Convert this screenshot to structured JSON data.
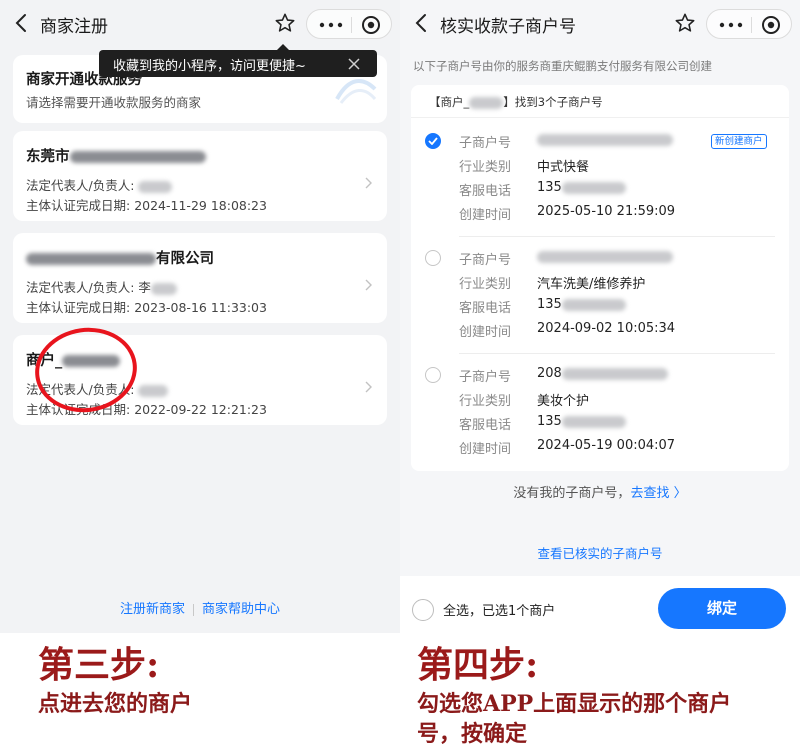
{
  "left": {
    "nav_title": "商家注册",
    "tooltip": "收藏到我的小程序，访问更便捷~",
    "card_intro": {
      "title": "商家开通收款服务",
      "sub": "请选择需要开通收款服务的商家"
    },
    "merchants": [
      {
        "name_prefix": "东莞市",
        "name_suffix": "",
        "rep_label": "法定代表人/负责人:",
        "date_label": "主体认证完成日期:",
        "date": "2024-11-29 18:08:23"
      },
      {
        "name_prefix": "",
        "name_suffix": "有限公司",
        "rep_label": "法定代表人/负责人:",
        "rep_prefix": "李",
        "date_label": "主体认证完成日期:",
        "date": "2023-08-16 11:33:03"
      },
      {
        "name_prefix": "商户_",
        "name_suffix": "",
        "rep_label": "法定代表人/负责人:",
        "date_label": "主体认证完成日期:",
        "date": "2022-09-22 12:21:23"
      }
    ],
    "footer": {
      "register": "注册新商家",
      "help": "商家帮助中心"
    },
    "caption_title": "第三步:",
    "caption_sub": "点进去您的商户"
  },
  "right": {
    "nav_title": "核实收款子商户号",
    "desc": "以下子商户号由你的服务商重庆鲲鹏支付服务有限公司创建",
    "found_prefix": "【商户_",
    "found_suffix": "】找到3个子商户号",
    "labels": {
      "sub_no": "子商户号",
      "industry": "行业类别",
      "phone": "客服电话",
      "created": "创建时间"
    },
    "sub_accounts": [
      {
        "industry": "中式快餐",
        "phone_prefix": "135",
        "created": "2025-05-10 21:59:09",
        "tag": "新创建商户",
        "checked": true
      },
      {
        "industry": "汽车洗美/维修养护",
        "phone_prefix": "135",
        "created": "2024-09-02 10:05:34",
        "checked": false
      },
      {
        "sub_prefix": "208",
        "industry": "美妆个护",
        "phone_prefix": "135",
        "created": "2024-05-19 00:04:07",
        "checked": false
      }
    ],
    "no_account": "没有我的子商户号，",
    "go_find": "去查找 〉",
    "view_verified": "查看已核实的子商户号",
    "select_all": "全选，已选1个商户",
    "bind_button": "绑定",
    "caption_title": "第四步:",
    "caption_line1": "勾选您APP上面显示的那个商户",
    "caption_line2": "号，按确定"
  },
  "colors": {
    "accent": "#1677ff",
    "caption": "#9b1a1a",
    "highlight": "#e8141d"
  }
}
